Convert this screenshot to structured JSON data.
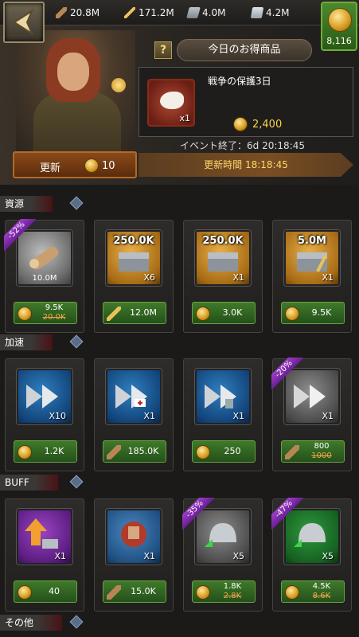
{
  "topbar": {
    "resources": [
      {
        "icon": "wood-icon",
        "value": "20.8M"
      },
      {
        "icon": "wheat-icon",
        "value": "171.2M"
      },
      {
        "icon": "iron-icon",
        "value": "4.0M"
      },
      {
        "icon": "stone-icon",
        "value": "4.2M"
      }
    ],
    "gold": "8,116"
  },
  "offer": {
    "title": "今日のお得商品",
    "help": "?",
    "item_name": "戦争の保護3日",
    "item_qty": "x1",
    "price": "2,400",
    "event_end": "イベント終了：6d 20:18:45",
    "refresh_label": "更新",
    "refresh_cost": "10",
    "refresh_time": "更新時間 18:18:45"
  },
  "sections": {
    "resources": "資源",
    "speedups": "加速",
    "buff": "BUFF",
    "other": "その他"
  },
  "resource_items": [
    {
      "badge": "-52%",
      "overlay": "",
      "qty": "",
      "sub": "10.0M",
      "price_now": "9.5K",
      "price_old": "20.0K",
      "price": ""
    },
    {
      "badge": "",
      "overlay": "250.0K",
      "qty": "X6",
      "sub": "",
      "price_now": "",
      "price_old": "",
      "price": "12.0M"
    },
    {
      "badge": "",
      "overlay": "250.0K",
      "qty": "X1",
      "sub": "",
      "price_now": "",
      "price_old": "",
      "price": "3.0K"
    },
    {
      "badge": "",
      "overlay": "5.0M",
      "qty": "X1",
      "sub": "",
      "price_now": "",
      "price_old": "",
      "price": "9.5K"
    }
  ],
  "speedup_items": [
    {
      "badge": "",
      "qty": "X10",
      "price": "1.2K",
      "price_now": "",
      "price_old": ""
    },
    {
      "badge": "",
      "qty": "X1",
      "price": "185.0K",
      "price_now": "",
      "price_old": ""
    },
    {
      "badge": "",
      "qty": "X1",
      "price": "250",
      "price_now": "",
      "price_old": ""
    },
    {
      "badge": "-20%",
      "qty": "X1",
      "price": "",
      "price_now": "800",
      "price_old": "1000"
    }
  ],
  "buff_items": [
    {
      "badge": "",
      "qty": "X1",
      "price": "40",
      "price_now": "",
      "price_old": ""
    },
    {
      "badge": "",
      "qty": "X1",
      "price": "15.0K",
      "price_now": "",
      "price_old": ""
    },
    {
      "badge": "-35%",
      "qty": "X5",
      "price": "",
      "price_now": "1.8K",
      "price_old": "2.8K"
    },
    {
      "badge": "-47%",
      "qty": "X5",
      "price": "",
      "price_now": "4.5K",
      "price_old": "8.6K"
    }
  ]
}
